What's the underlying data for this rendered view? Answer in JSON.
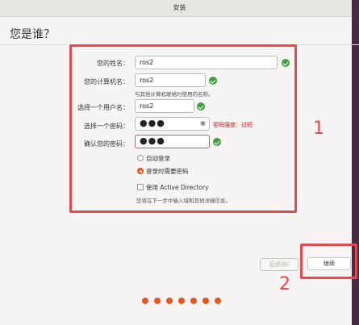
{
  "window": {
    "title": "安装"
  },
  "page": {
    "title": "您是谁？"
  },
  "form": {
    "name_label": "您的姓名：",
    "name_value": "ros2",
    "computer_label": "您的计算机名：",
    "computer_value": "ros2",
    "computer_hint": "与其他计算机联络时使用的名称。",
    "username_label": "选择一个用户名：",
    "username_value": "ros2",
    "password_label": "选择一个密码：",
    "password_value": "●●●",
    "password_strength": "密码强度：过短",
    "confirm_label": "确认您的密码：",
    "confirm_value": "●●●",
    "auto_login_label": "自动登录",
    "require_password_label": "登录时需要密码",
    "login_mode_selected": "登录时需要密码",
    "active_directory_label": "使用 Active Directory",
    "active_directory_checked": false,
    "active_directory_hint": "您将在下一步中输入域和其他详细信息。"
  },
  "buttons": {
    "back_label": "后退(B)",
    "continue_label": "继续"
  },
  "annotations": {
    "box1_number": "1",
    "box2_number": "2"
  },
  "progress": {
    "total_steps": 7
  },
  "colors": {
    "accent": "#e95420",
    "check": "#3e9e3e",
    "annotation": "#e5484d",
    "strength": "#c7162b"
  },
  "icons": {
    "valid": "check-circle-icon",
    "show_password": "eye-icon"
  }
}
